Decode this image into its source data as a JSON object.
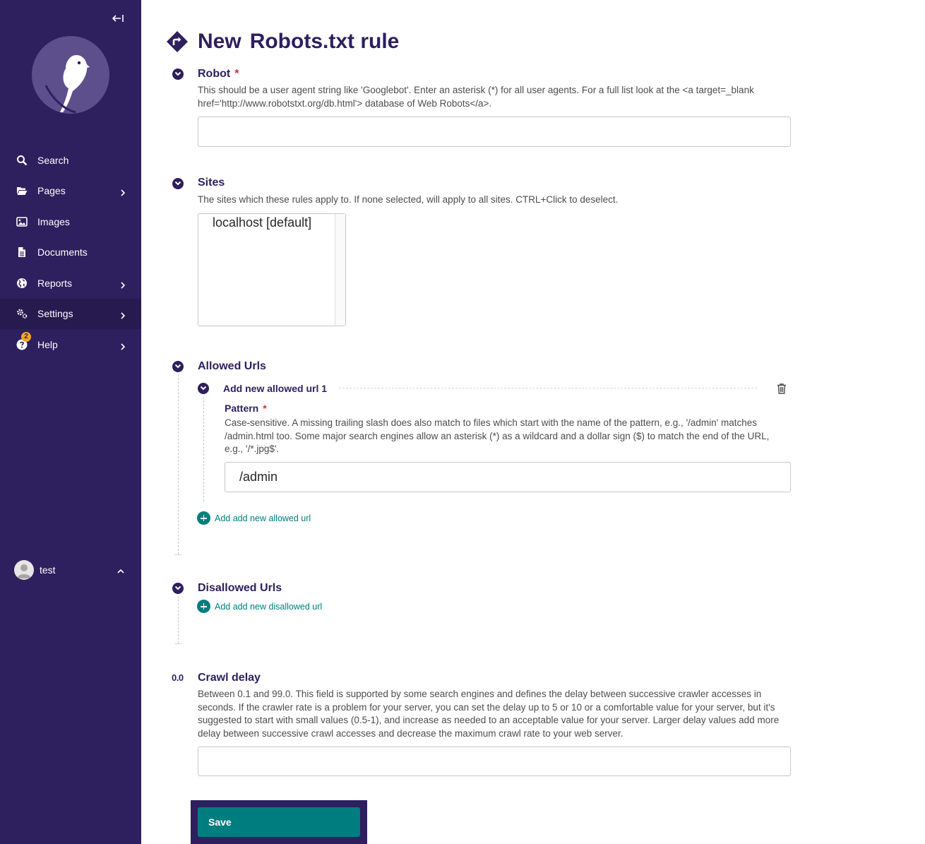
{
  "sidebar": {
    "items": [
      {
        "label": "Search",
        "icon": "search-icon",
        "has_submenu": false
      },
      {
        "label": "Pages",
        "icon": "folder-open-icon",
        "has_submenu": true
      },
      {
        "label": "Images",
        "icon": "image-icon",
        "has_submenu": false
      },
      {
        "label": "Documents",
        "icon": "document-icon",
        "has_submenu": false
      },
      {
        "label": "Reports",
        "icon": "globe-icon",
        "has_submenu": true
      },
      {
        "label": "Settings",
        "icon": "cogs-icon",
        "has_submenu": true,
        "active": true
      },
      {
        "label": "Help",
        "icon": "help-icon",
        "has_submenu": true,
        "badge": "2"
      }
    ],
    "user": {
      "name": "test"
    }
  },
  "header": {
    "title_bold": "New",
    "title_rest": "Robots.txt rule"
  },
  "form": {
    "robot": {
      "label": "Robot",
      "required_mark": "*",
      "help": "This should be a user agent string like 'Googlebot'. Enter an asterisk (*) for all user agents. For a full list look at the <a target=_blank href='http://www.robotstxt.org/db.html'> database of Web Robots</a>.",
      "value": ""
    },
    "sites": {
      "label": "Sites",
      "help": "The sites which these rules apply to. If none selected, will apply to all sites. CTRL+Click to deselect.",
      "options": [
        "localhost [default]"
      ]
    },
    "allowed_urls": {
      "label": "Allowed Urls",
      "child_label": "Add new allowed url 1",
      "pattern_label": "Pattern",
      "required_mark": "*",
      "pattern_help": "Case-sensitive. A missing trailing slash does also match to files which start with the name of the pattern, e.g., '/admin' matches /admin.html too. Some major search engines allow an asterisk (*) as a wildcard and a dollar sign ($) to match the end of the URL, e.g., '/*.jpg$'.",
      "pattern_value": "/admin",
      "add_label": "Add add new allowed url"
    },
    "disallowed_urls": {
      "label": "Disallowed Urls",
      "add_label": "Add add new disallowed url"
    },
    "crawl_delay": {
      "label": "Crawl delay",
      "icon_text": "0.0",
      "help": "Between 0.1 and 99.0. This field is supported by some search engines and defines the delay between successive crawler accesses in seconds. If the crawler rate is a problem for your server, you can set the delay up to 5 or 10 or a comfortable value for your server, but it's suggested to start with small values (0.5-1), and increase as needed to an acceptable value for your server. Larger delay values add more delay between successive crawl accesses and decrease the maximum crawl rate to your web server.",
      "value": ""
    }
  },
  "footer": {
    "save_label": "Save"
  },
  "colors": {
    "sidebar": "#2e1f5e",
    "accent": "#007d7e",
    "required": "#cd3238",
    "badge": "#f5a623"
  }
}
